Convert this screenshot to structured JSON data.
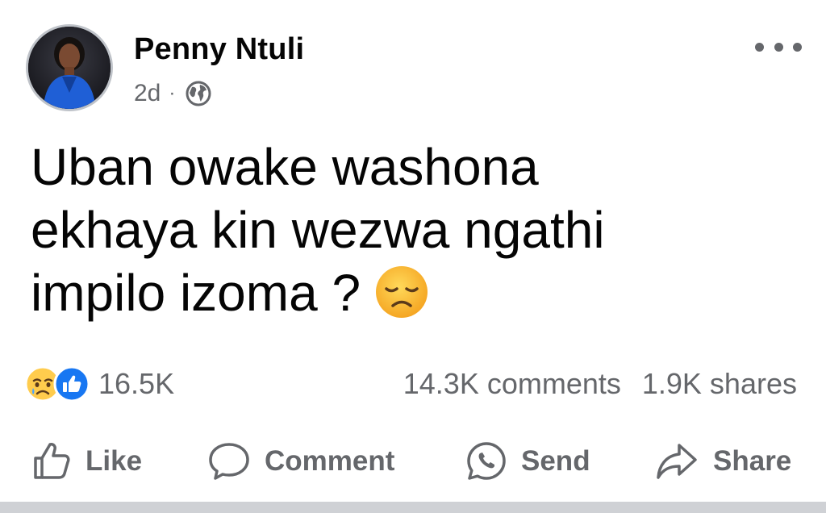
{
  "author": {
    "name": "Penny Ntuli"
  },
  "meta": {
    "time": "2d",
    "separator": "·",
    "audience_icon": "globe-icon"
  },
  "post": {
    "lines": [
      "Uban owake washona",
      "ekhaya kin wezwa ngathi",
      "impilo izoma ?"
    ],
    "emoji": "disappointed-face-emoji"
  },
  "reactions": {
    "icons": [
      "sad-reaction-icon",
      "like-reaction-icon"
    ],
    "count": "16.5K"
  },
  "stats": {
    "comments": "14.3K comments",
    "shares": "1.9K shares"
  },
  "actions": {
    "like": "Like",
    "comment": "Comment",
    "send": "Send",
    "share": "Share"
  },
  "colors": {
    "text_primary": "#050505",
    "text_secondary": "#65676b",
    "like_blue": "#1877f2",
    "emoji_yellow": "#ffc83d",
    "avatar_jacket": "#1f5fd6"
  }
}
